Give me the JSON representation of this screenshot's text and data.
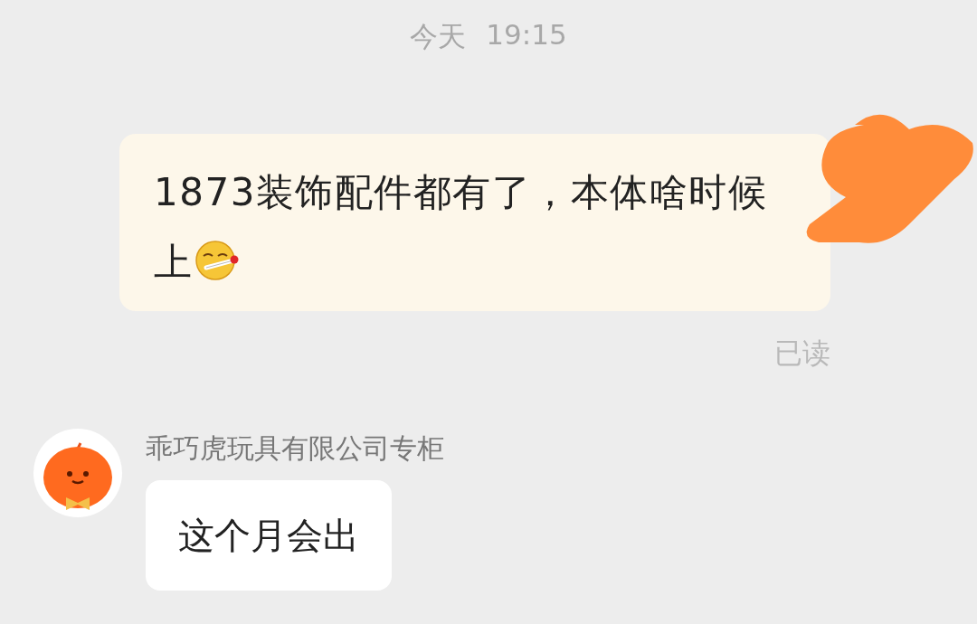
{
  "timestamp": {
    "day": "今天",
    "time": "19:15"
  },
  "outgoing": {
    "text": "1873装饰配件都有了，本体啥时候上",
    "status": "已读"
  },
  "incoming": {
    "sender": "乖巧虎玩具有限公司专柜",
    "text": "这个月会出"
  }
}
